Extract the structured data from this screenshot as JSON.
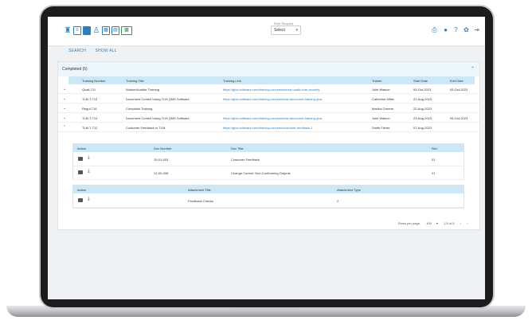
{
  "toolbar": {
    "icons": [
      "ribbon-icon",
      "document-icon",
      "list-icon",
      "user-icon",
      "calendar-icon",
      "chart-icon",
      "grid-report-icon"
    ],
    "role_select": {
      "label": "Role Request",
      "value": "Select"
    },
    "right_icons": [
      "print-icon",
      "globe-icon",
      "help-icon",
      "settings-icon",
      "logout-icon"
    ]
  },
  "links": {
    "search": "SEARCH",
    "show_all": "SHOW ALL"
  },
  "section": {
    "title": "Completed (5)"
  },
  "table": {
    "headers": [
      "Training Number",
      "Training Title",
      "Training Link",
      "Trainer",
      "Start Date",
      "End Date"
    ],
    "rows": [
      {
        "number": "Quali-711",
        "title": "Worker/Auditor Training",
        "link": "https://gbtc.software.com/training-courses/worker-audit-core-security",
        "trainer": "Jolie Watson",
        "start": "05-Oct-2023",
        "end": "05-Oct-2023"
      },
      {
        "number": "TLM T-713",
        "title": "Document Control Using TLM QMS Software",
        "link": "https://gbtc.software.com/training-courses/new-document-training-quiz",
        "trainer": "Catherine Miller",
        "start": "22-Aug-2023",
        "end": ""
      },
      {
        "number": "Regul-716",
        "title": "Complaint Training",
        "link": "",
        "trainer": "Martha Greene",
        "start": "22-Aug-2023",
        "end": ""
      },
      {
        "number": "TLM T-714",
        "title": "Document Control Using TLM QMS Software",
        "link": "https://gbtc.software.com/training-courses/new-document-training-quiz",
        "trainer": "Jolie Watson",
        "start": "23-Aug-2023",
        "end": "05-Oct-2023"
      },
      {
        "number": "TLM T-712",
        "title": "Customer Feedback in TLM",
        "link": "https://gbtc.software.com/training-courses/customer-feedback-1",
        "trainer": "Smith Fisher",
        "start": "07-Aug-2023",
        "end": ""
      }
    ]
  },
  "docs": {
    "headers": [
      "Action",
      "Doc Number",
      "Doc Title",
      "Rev"
    ],
    "rows": [
      {
        "number": "15-01-003",
        "title": "Customer Feedback",
        "rev": "01"
      },
      {
        "number": "12-00-008",
        "title": "Change Control: Non-Conforming Outputs",
        "rev": "01"
      }
    ]
  },
  "attachments": {
    "headers": [
      "Action",
      "Attachment Title",
      "Attachment Type"
    ],
    "rows": [
      {
        "title": "Feedback Checks",
        "type": "2"
      }
    ]
  },
  "pager": {
    "rows_label": "Rows per page:",
    "rows_value": "100",
    "range": "1-5 of 5"
  },
  "colors": {
    "accent": "#2c7fc1",
    "header_blue": "#cce7f5",
    "panel_head": "#edf6fb"
  }
}
